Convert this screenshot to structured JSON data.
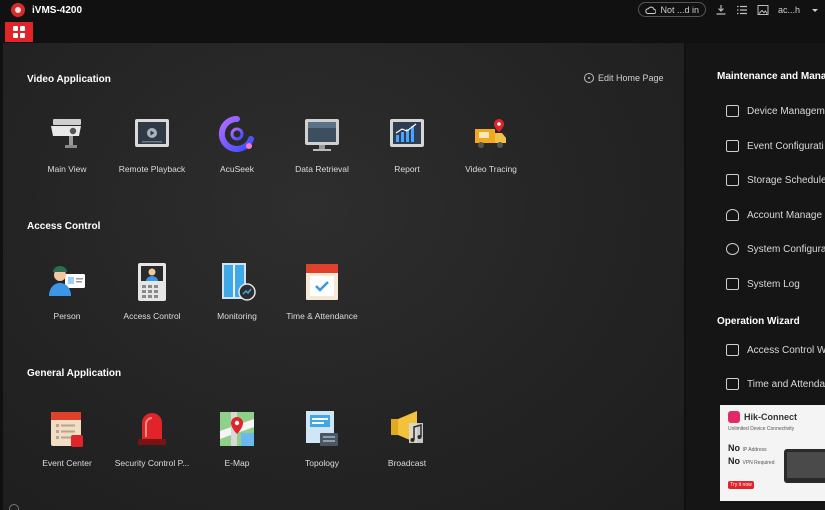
{
  "window": {
    "title": "iVMS-4200",
    "cloud_status": "Not ...d in",
    "user": "ac...h"
  },
  "colors": {
    "accent": "#e0242a",
    "background": "#242424",
    "side_panel": "#151515"
  },
  "main": {
    "edit_home_label": "Edit Home Page",
    "sections": [
      {
        "title": "Video Application",
        "apps": [
          {
            "label": "Main View",
            "icon": "camera-icon"
          },
          {
            "label": "Remote Playback",
            "icon": "playback-icon"
          },
          {
            "label": "AcuSeek",
            "icon": "acuseek-icon"
          },
          {
            "label": "Data Retrieval",
            "icon": "data-retrieval-icon"
          },
          {
            "label": "Report",
            "icon": "report-icon"
          },
          {
            "label": "Video Tracing",
            "icon": "video-tracing-icon"
          }
        ]
      },
      {
        "title": "Access Control",
        "apps": [
          {
            "label": "Person",
            "icon": "person-icon"
          },
          {
            "label": "Access Control",
            "icon": "door-station-icon"
          },
          {
            "label": "Monitoring",
            "icon": "monitoring-icon"
          },
          {
            "label": "Time & Attendance",
            "icon": "calendar-icon"
          }
        ]
      },
      {
        "title": "General Application",
        "apps": [
          {
            "label": "Event Center",
            "icon": "event-center-icon"
          },
          {
            "label": "Security Control P...",
            "icon": "alarm-light-icon"
          },
          {
            "label": "E-Map",
            "icon": "map-icon"
          },
          {
            "label": "Topology",
            "icon": "topology-icon"
          },
          {
            "label": "Broadcast",
            "icon": "broadcast-icon"
          }
        ]
      }
    ]
  },
  "side": {
    "maintenance_title": "Maintenance and Mana",
    "maintenance_items": [
      {
        "label": "Device Managem",
        "icon": "device-icon"
      },
      {
        "label": "Event Configurati",
        "icon": "event-config-icon"
      },
      {
        "label": "Storage Schedule",
        "icon": "storage-icon"
      },
      {
        "label": "Account Manage",
        "icon": "account-icon"
      },
      {
        "label": "System Configura",
        "icon": "system-config-icon"
      },
      {
        "label": "System Log",
        "icon": "log-icon"
      }
    ],
    "wizard_title": "Operation Wizard",
    "wizard_items": [
      {
        "label": "Access Control W",
        "icon": "wizard-icon"
      },
      {
        "label": "Time and Attenda",
        "icon": "wizard-icon"
      }
    ],
    "banner": {
      "title": "Hik-Connect",
      "subtitle": "Unlimited Device Connectivity",
      "line1": "No",
      "line1_small": "IP Address",
      "line2": "No",
      "line2_small": "VPN Required",
      "button": "Try it now"
    }
  }
}
